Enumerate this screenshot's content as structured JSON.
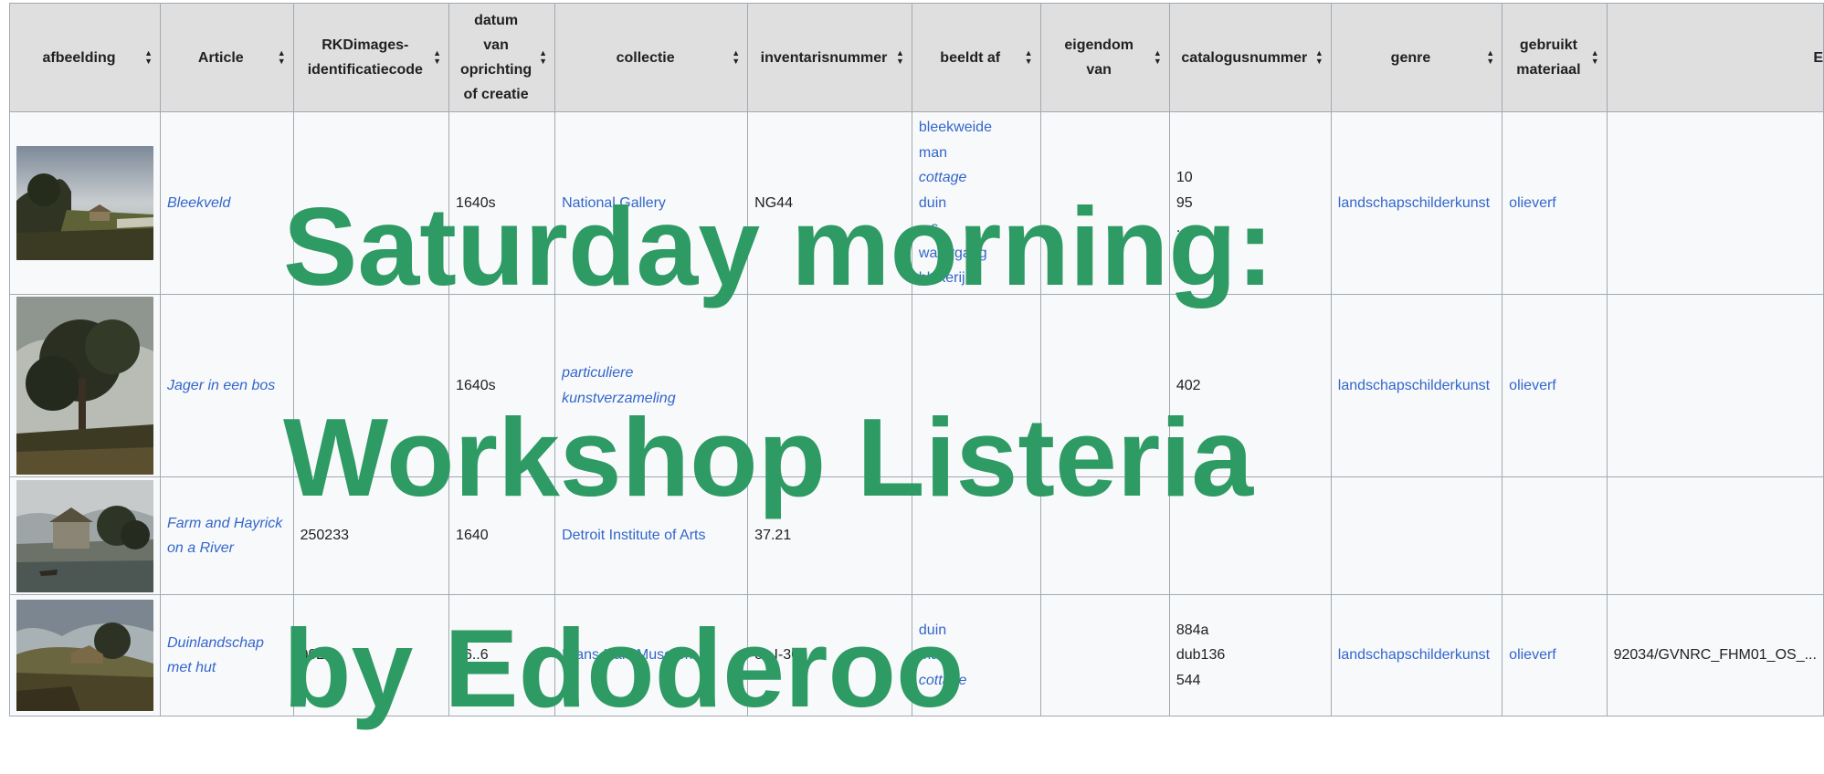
{
  "table": {
    "headers": [
      {
        "key": "afbeelding",
        "label": "afbeelding",
        "lines": [
          "afbeelding"
        ]
      },
      {
        "key": "article",
        "label": "Article",
        "lines": [
          "Article"
        ]
      },
      {
        "key": "rkd",
        "label": "RKDimages-identificatiecode",
        "lines": [
          "RKDimages-",
          "identificatiecode"
        ]
      },
      {
        "key": "datum",
        "label": "datum van oprichting of creatie",
        "lines": [
          "datum",
          "van",
          "oprichting",
          "of creatie"
        ]
      },
      {
        "key": "collectie",
        "label": "collectie",
        "lines": [
          "collectie"
        ]
      },
      {
        "key": "inventaris",
        "label": "inventarisnummer",
        "lines": [
          "inventarisnummer"
        ]
      },
      {
        "key": "beeldt",
        "label": "beeldt af",
        "lines": [
          "beeldt af"
        ]
      },
      {
        "key": "eigendom",
        "label": "eigendom van",
        "lines": [
          "eigendom",
          "van"
        ]
      },
      {
        "key": "catalogus",
        "label": "catalogusnummer",
        "lines": [
          "catalogusnummer"
        ]
      },
      {
        "key": "genre",
        "label": "genre",
        "lines": [
          "genre"
        ]
      },
      {
        "key": "materiaal",
        "label": "gebruikt materiaal",
        "lines": [
          "gebruikt",
          "materiaal"
        ]
      },
      {
        "key": "extra",
        "label": "E",
        "lines": [
          "E"
        ]
      }
    ],
    "rows": [
      {
        "article": "Bleekveld",
        "rkd": "",
        "datum": "1640s",
        "collectie": "National Gallery",
        "inventaris": "NG44",
        "beeldt": [
          {
            "text": "bleekweide",
            "italic": false
          },
          {
            "text": "man",
            "italic": false
          },
          {
            "text": "cottage",
            "italic": true
          },
          {
            "text": "duin",
            "italic": false
          },
          {
            "text": "...s",
            "italic": false
          },
          {
            "text": "watergang",
            "italic": false
          },
          {
            "text": "blekerij",
            "italic": false
          }
        ],
        "eigendom": "",
        "catalogus": [
          "10",
          "95",
          "..."
        ],
        "genre": "landschapschilderkunst",
        "materiaal": "olieverf",
        "extra": ""
      },
      {
        "article": "Jager in een bos",
        "rkd": "",
        "datum": "1640s",
        "collectie": "particuliere kunstverzameling",
        "inventaris": "",
        "beeldt": [],
        "eigendom": "",
        "catalogus": [
          "402"
        ],
        "genre": "landschapschilderkunst",
        "materiaal": "olieverf",
        "extra": ""
      },
      {
        "article": "Farm and Hayrick on a River",
        "rkd": "250233",
        "datum": "1640",
        "collectie": "Detroit Institute of Arts",
        "inventaris": "37.21",
        "beeldt": [],
        "eigendom": "",
        "catalogus": [],
        "genre": "",
        "materiaal": "",
        "extra": ""
      },
      {
        "article": "Duinlandschap met hut",
        "rkd": "902...",
        "datum": "16..6",
        "collectie": "Frans Hals Museum",
        "inventaris": "os I-308",
        "beeldt": [
          {
            "text": "duin",
            "italic": false
          },
          {
            "text": "man",
            "italic": false
          },
          {
            "text": "cottage",
            "italic": true
          }
        ],
        "eigendom": "",
        "catalogus": [
          "884a",
          "dub136",
          "544"
        ],
        "genre": "landschapschilderkunst",
        "materiaal": "olieverf",
        "extra": "92034/GVNRC_FHM01_OS_..."
      }
    ]
  },
  "overlay": {
    "line1": "Saturday morning:",
    "line2": "Workshop Listeria",
    "line3": "by Edoderoo"
  }
}
